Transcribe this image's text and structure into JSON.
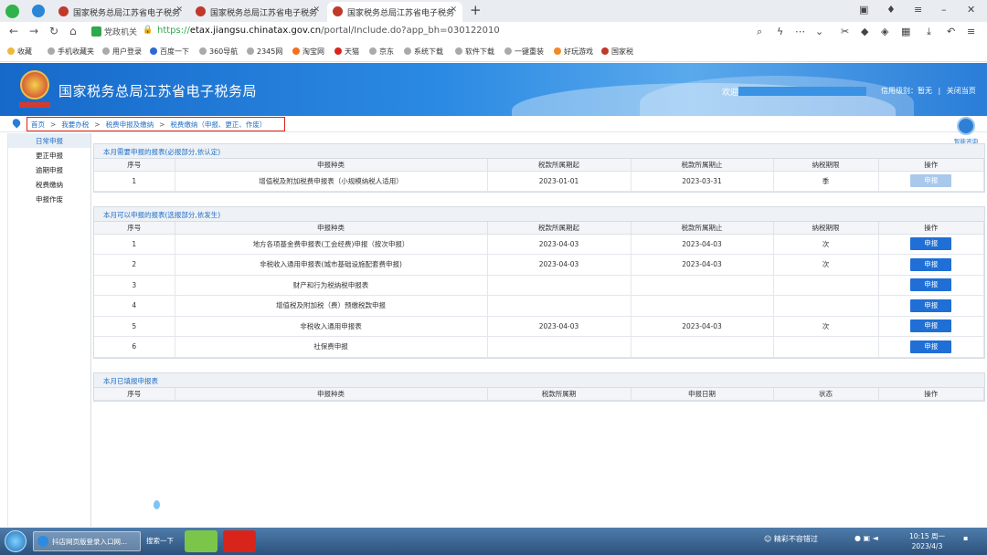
{
  "browser": {
    "tabs": [
      {
        "label": "国家税务总局江苏省电子税务"
      },
      {
        "label": "国家税务总局江苏省电子税务"
      },
      {
        "label": "国家税务总局江苏省电子税务"
      }
    ],
    "new_tab": "+",
    "address": {
      "group": "党政机关",
      "scheme": "https://",
      "host": "etax.jiangsu.chinatax.gov.cn",
      "path": "/portal/Include.do?app_bh=030122010"
    },
    "bookmarks": [
      "收藏",
      "手机收藏夹",
      "用户登录",
      "百度一下",
      "360导航",
      "2345网",
      "淘宝网",
      "天猫",
      "京东",
      "系统下载",
      "软件下载",
      "一键重装",
      "好玩游戏",
      "国家税"
    ]
  },
  "banner": {
    "title": "国家税务总局江苏省电子税务局",
    "welcome": "欢迎",
    "credit": "信用级别：暂无",
    "separator": "|",
    "close": "关闭当页"
  },
  "breadcrumb": [
    "首页",
    "我要办税",
    "税费申报及缴纳",
    "税费缴纳（申报、更正、作废）"
  ],
  "breadcrumb_sep": ">",
  "help": {
    "label": "智能咨询"
  },
  "sidebar": {
    "items": [
      {
        "label": "日常申报"
      },
      {
        "label": "更正申报"
      },
      {
        "label": "逾期申报"
      },
      {
        "label": "税费缴纳"
      },
      {
        "label": "申报作废"
      }
    ]
  },
  "panel1": {
    "title": "本月需要申报的报表(必报部分,依认定)",
    "headers": [
      "序号",
      "申报种类",
      "税款所属期起",
      "税款所属期止",
      "纳税期限",
      "操作"
    ],
    "rows": [
      {
        "no": "1",
        "type": "增值税及附加税费申报表（小规模纳税人适用）",
        "start": "2023-01-01",
        "end": "2023-03-31",
        "period": "季",
        "action": "申报"
      }
    ]
  },
  "panel2": {
    "title": "本月可以申报的报表(选报部分,依发生)",
    "headers": [
      "序号",
      "申报种类",
      "税款所属期起",
      "税款所属期止",
      "纳税期限",
      "操作"
    ],
    "rows": [
      {
        "no": "1",
        "type": "地方各项基金费申报表(工会经费)申报（按次申报）",
        "start": "2023-04-03",
        "end": "2023-04-03",
        "period": "次",
        "action": "申报"
      },
      {
        "no": "2",
        "type": "非税收入通用申报表(城市基础设施配套费申报)",
        "start": "2023-04-03",
        "end": "2023-04-03",
        "period": "次",
        "action": "申报"
      },
      {
        "no": "3",
        "type": "财产和行为税纳税申报表",
        "start": "",
        "end": "",
        "period": "",
        "action": "申报"
      },
      {
        "no": "4",
        "type": "增值税及附加税（费）预缴税款申报",
        "start": "",
        "end": "",
        "period": "",
        "action": "申报"
      },
      {
        "no": "5",
        "type": "非税收入通用申报表",
        "start": "2023-04-03",
        "end": "2023-04-03",
        "period": "次",
        "action": "申报"
      },
      {
        "no": "6",
        "type": "社保费申报",
        "start": "",
        "end": "",
        "period": "",
        "action": "申报"
      }
    ]
  },
  "panel3": {
    "title": "本月已填报申报表",
    "headers": [
      "序号",
      "申报种类",
      "税款所属期",
      "申报日期",
      "状态",
      "操作"
    ]
  },
  "taskbar": {
    "task": "抖店网页版登录入口网...",
    "search": "搜索一下",
    "tray_text": "精彩不容错过",
    "time": "10:15 周一",
    "date": "2023/4/3"
  }
}
